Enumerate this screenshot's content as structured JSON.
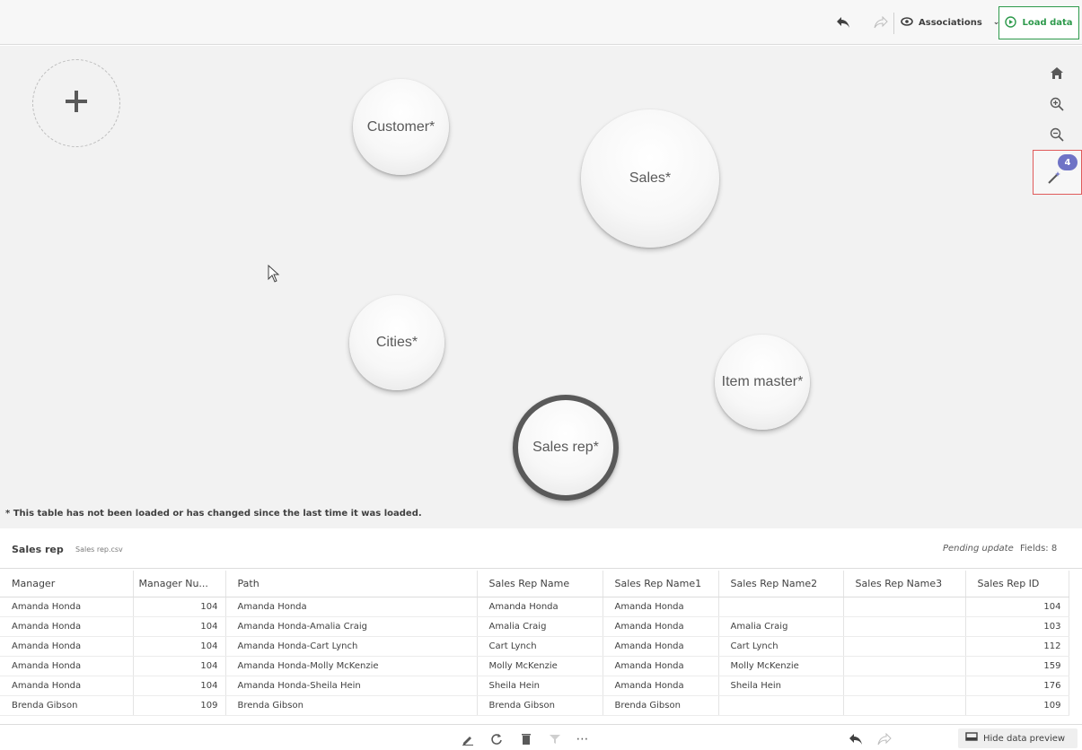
{
  "toolbar": {
    "undo_icon": "undo-icon",
    "redo_icon": "redo-icon",
    "associations_label": "Associations",
    "load_data_label": "Load data",
    "accent": "#2e9a4c"
  },
  "canvas": {
    "add_icon": "plus-icon",
    "tables": [
      "Customer*",
      "Sales*",
      "Cities*",
      "Item master*",
      "Sales rep*"
    ],
    "selected_table": "Sales rep*",
    "recommendations_count": "4",
    "footnote": "* This table has not been loaded or has changed since the last time it was loaded."
  },
  "preview": {
    "table_name": "Sales rep",
    "file_name": "Sales rep.csv",
    "status": "Pending update",
    "fields": "Fields: 8",
    "columns": [
      "Manager",
      "Manager Nu...",
      "Path",
      "Sales Rep Name",
      "Sales Rep Name1",
      "Sales Rep Name2",
      "Sales Rep Name3",
      "Sales Rep ID"
    ],
    "rows": [
      [
        "Amanda Honda",
        "104",
        "Amanda Honda",
        "Amanda Honda",
        "Amanda Honda",
        "",
        "",
        "104"
      ],
      [
        "Amanda Honda",
        "104",
        "Amanda Honda-Amalia Craig",
        "Amalia Craig",
        "Amanda Honda",
        "Amalia Craig",
        "",
        "103"
      ],
      [
        "Amanda Honda",
        "104",
        "Amanda Honda-Cart Lynch",
        "Cart Lynch",
        "Amanda Honda",
        "Cart Lynch",
        "",
        "112"
      ],
      [
        "Amanda Honda",
        "104",
        "Amanda Honda-Molly McKenzie",
        "Molly McKenzie",
        "Amanda Honda",
        "Molly McKenzie",
        "",
        "159"
      ],
      [
        "Amanda Honda",
        "104",
        "Amanda Honda-Sheila Hein",
        "Sheila Hein",
        "Amanda Honda",
        "Sheila Hein",
        "",
        "176"
      ],
      [
        "Brenda Gibson",
        "109",
        "Brenda Gibson",
        "Brenda Gibson",
        "Brenda Gibson",
        "",
        "",
        "109"
      ]
    ]
  },
  "bottom_bar": {
    "hide_preview_label": "Hide data preview"
  }
}
